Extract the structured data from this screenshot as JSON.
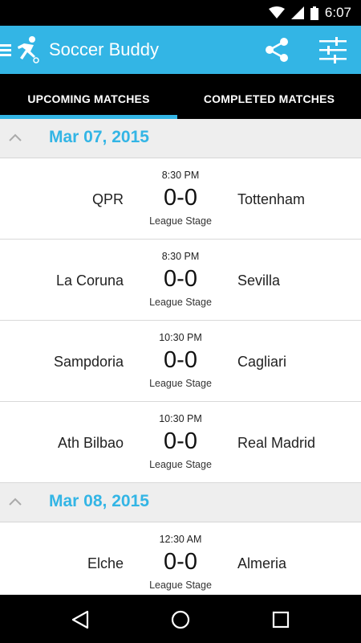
{
  "status_bar": {
    "time": "6:07"
  },
  "app_bar": {
    "title": "Soccer Buddy",
    "accent_color": "#33b5e5"
  },
  "tabs": [
    {
      "label": "UPCOMING MATCHES",
      "selected": true
    },
    {
      "label": "COMPLETED MATCHES",
      "selected": false
    }
  ],
  "groups": [
    {
      "date": "Mar 07, 2015",
      "matches": [
        {
          "time": "8:30 PM",
          "home": "QPR",
          "score": "0-0",
          "away": "Tottenham",
          "stage": "League Stage"
        },
        {
          "time": "8:30 PM",
          "home": "La Coruna",
          "score": "0-0",
          "away": "Sevilla",
          "stage": "League Stage"
        },
        {
          "time": "10:30 PM",
          "home": "Sampdoria",
          "score": "0-0",
          "away": "Cagliari",
          "stage": "League Stage"
        },
        {
          "time": "10:30 PM",
          "home": "Ath Bilbao",
          "score": "0-0",
          "away": "Real Madrid",
          "stage": "League Stage"
        }
      ]
    },
    {
      "date": "Mar 08, 2015",
      "matches": [
        {
          "time": "12:30 AM",
          "home": "Elche",
          "score": "0-0",
          "away": "Almeria",
          "stage": "League Stage"
        }
      ]
    }
  ]
}
